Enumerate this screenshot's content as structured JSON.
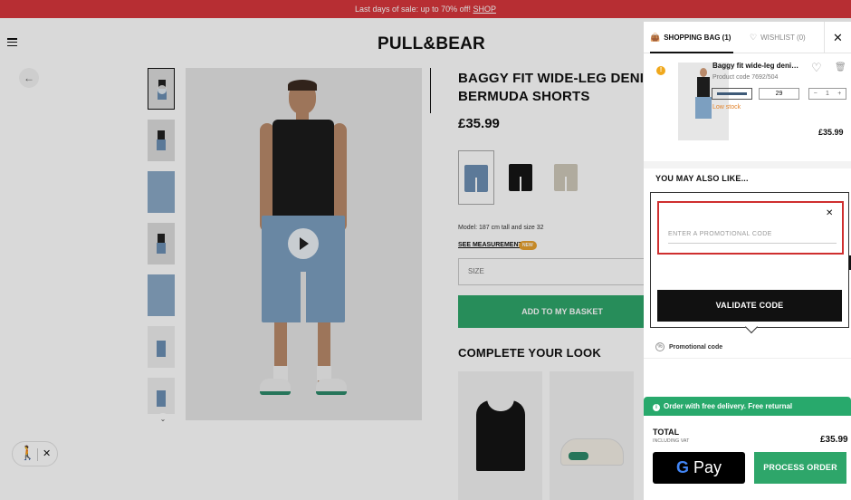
{
  "promo_bar": {
    "text": "Last days of sale: up to 70% off! ",
    "link": "SHOP"
  },
  "header": {
    "logo": "PULL&BEAR"
  },
  "product": {
    "title": "BAGGY FIT WIDE-LEG DENIM BERMUDA SHORTS",
    "price": "£35.99",
    "colors": [
      {
        "name": "blue",
        "hex": "#6d8fb3"
      },
      {
        "name": "black",
        "hex": "#161616"
      },
      {
        "name": "beige",
        "hex": "#cfc9ba"
      }
    ],
    "model_info": "Model: 187 cm tall and size 32",
    "see_measurements": "SEE MEASUREMENTS",
    "new_badge": "NEW",
    "size_placeholder": "SIZE",
    "add_to_basket": "ADD TO MY BASKET"
  },
  "complete_look": {
    "title": "COMPLETE YOUR LOOK"
  },
  "accessibility": {
    "icon": "accessibility-icon",
    "close": "✕"
  },
  "cart_panel": {
    "tab_bag": "SHOPPING BAG (1)",
    "tab_wishlist": "WISHLIST (0)",
    "close": "✕",
    "item": {
      "name": "Baggy fit wide-leg denim Bermuda shorts",
      "code": "Product code 7692/504",
      "size": "29",
      "qty_minus": "−",
      "qty_value": "1",
      "qty_plus": "+",
      "low_stock": "Low stock",
      "price": "£35.99",
      "warning": "!"
    },
    "also_like": "YOU MAY ALSO LIKE...",
    "promo": {
      "close": "✕",
      "placeholder": "ENTER A PROMOTIONAL CODE",
      "validate": "VALIDATE CODE",
      "link": "Promotional code"
    },
    "delivery_banner": "Order with free delivery. Free returnal",
    "total_label": "TOTAL",
    "vat_label": "INCLUDING VAT",
    "total_price": "£35.99",
    "gpay_g": "G",
    "gpay_text": " Pay",
    "process_order": "PROCESS ORDER"
  }
}
